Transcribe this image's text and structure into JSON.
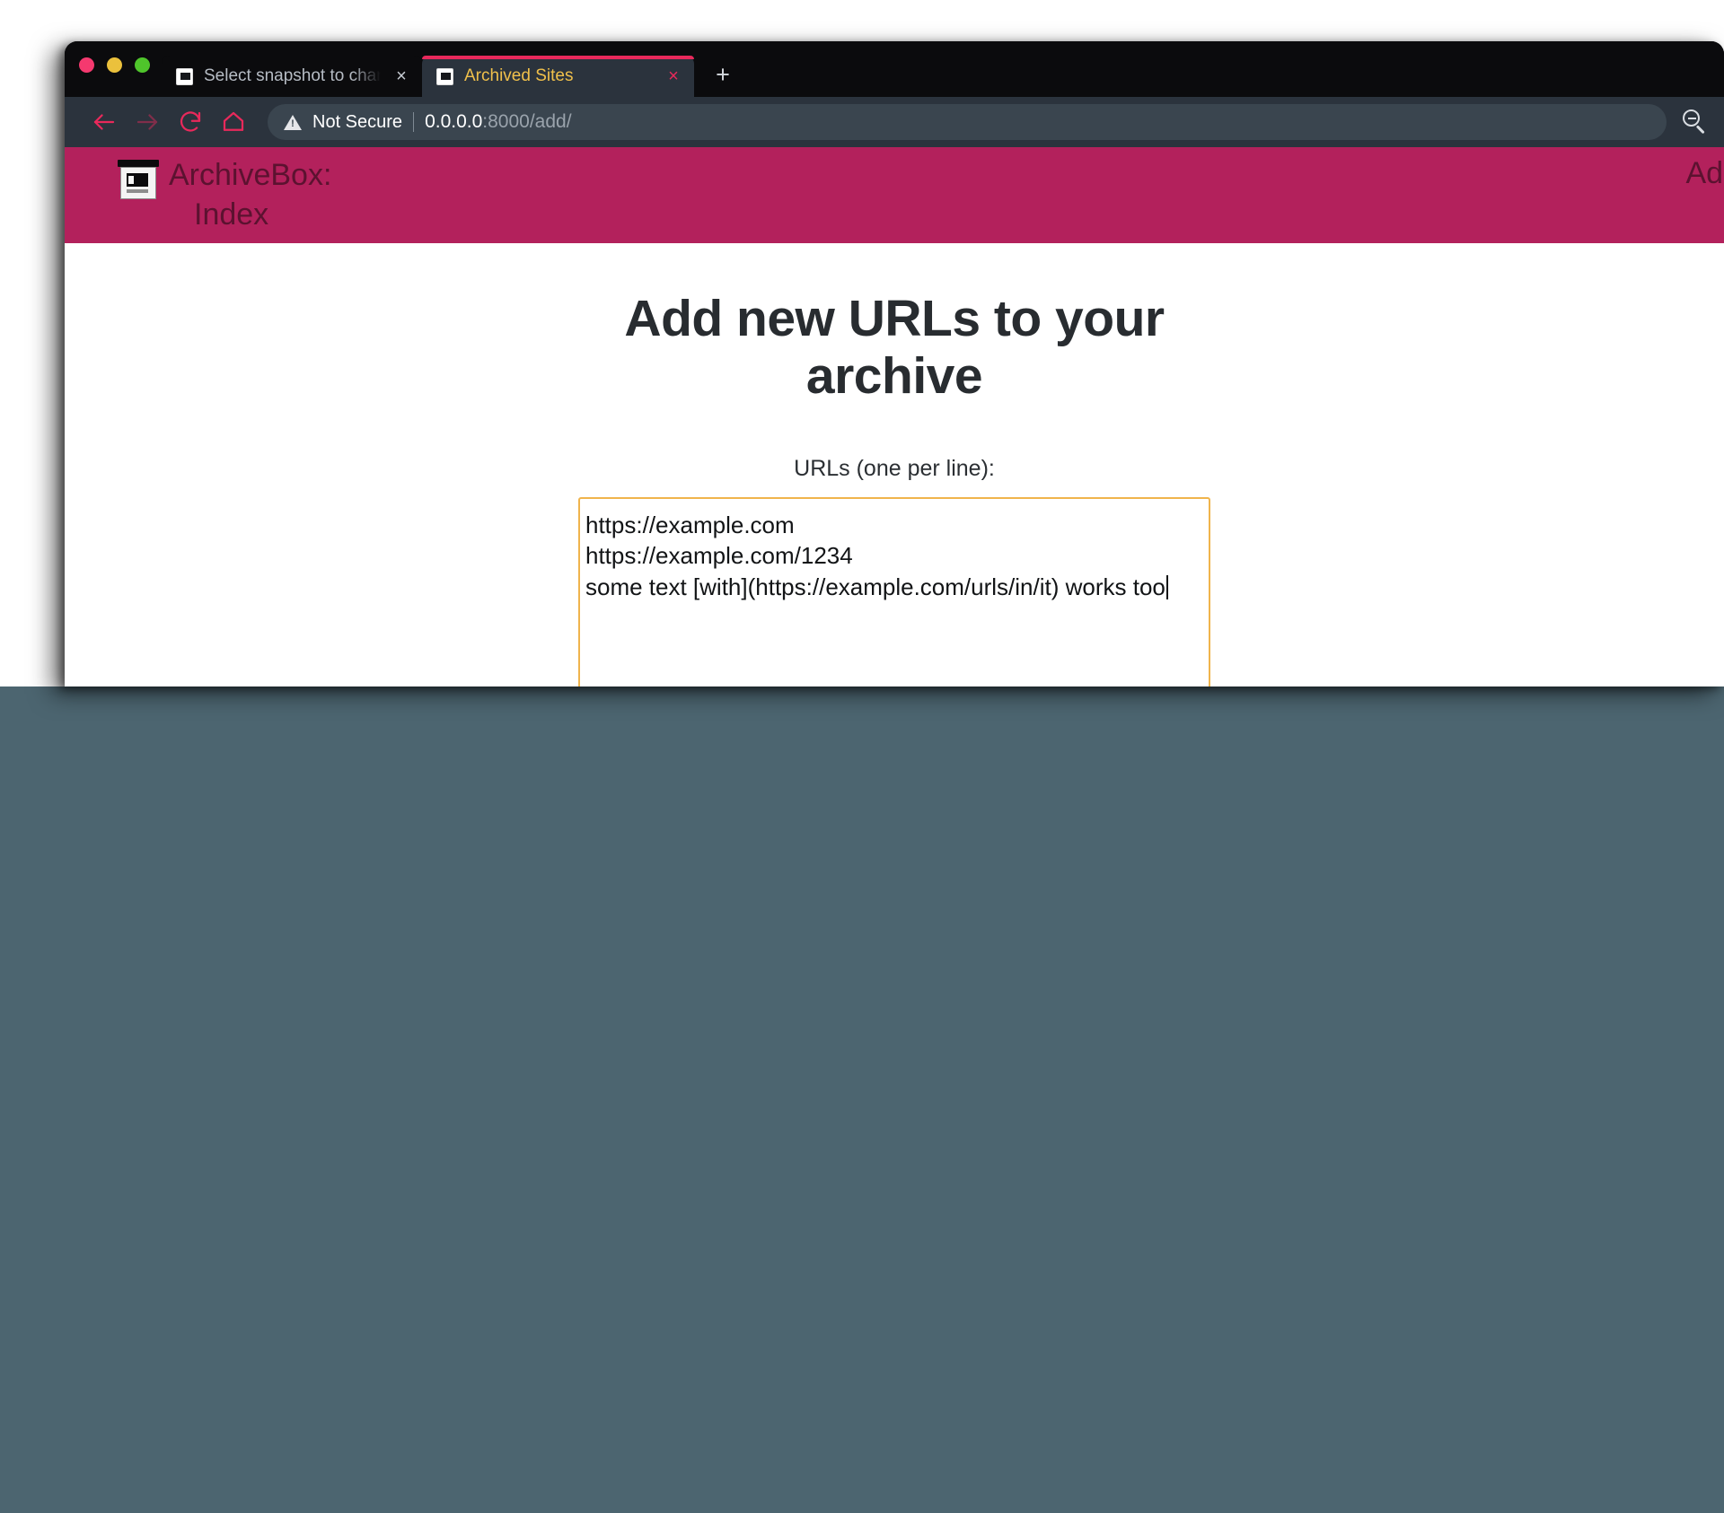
{
  "window": {
    "traffic_lights": [
      "close",
      "minimize",
      "maximize"
    ],
    "new_tab_label": "+"
  },
  "tabs": [
    {
      "title": "Select snapshot to change | Ind",
      "close_label": "×",
      "active": false,
      "favicon": "archivebox-favicon"
    },
    {
      "title": "Archived Sites",
      "close_label": "×",
      "active": true,
      "favicon": "archivebox-favicon"
    }
  ],
  "toolbar": {
    "back_label": "←",
    "forward_label": "→",
    "reload_label": "↻",
    "home_label": "⌂",
    "security_text": "Not Secure",
    "url_host": "0.0.0.0",
    "url_rest": ":8000/add/",
    "zoom_out_icon": "zoom-out-icon"
  },
  "site_header": {
    "brand_primary": "ArchiveBox:",
    "brand_secondary": "Index",
    "nav_right": "Add",
    "background_color": "#b3215c",
    "text_color": "#5c1230"
  },
  "main": {
    "title": "Add new URLs to your archive",
    "field_label": "URLs (one per line):",
    "textarea": {
      "lines": [
        "https://example.com",
        "https://example.com/1234",
        "some text [with](https://example.com/urls/in/it) works too"
      ],
      "border_color": "#f0b44c",
      "focused": true
    }
  },
  "colors": {
    "accent_pink": "#e8295b",
    "header_magenta": "#b3215c",
    "tab_active_bg": "#2b333d",
    "chrome_dark": "#0b0b0d",
    "toolbar_bg": "#2b333d",
    "backdrop_lower": "#4c6570",
    "tab_active_text": "#f0c04b"
  }
}
